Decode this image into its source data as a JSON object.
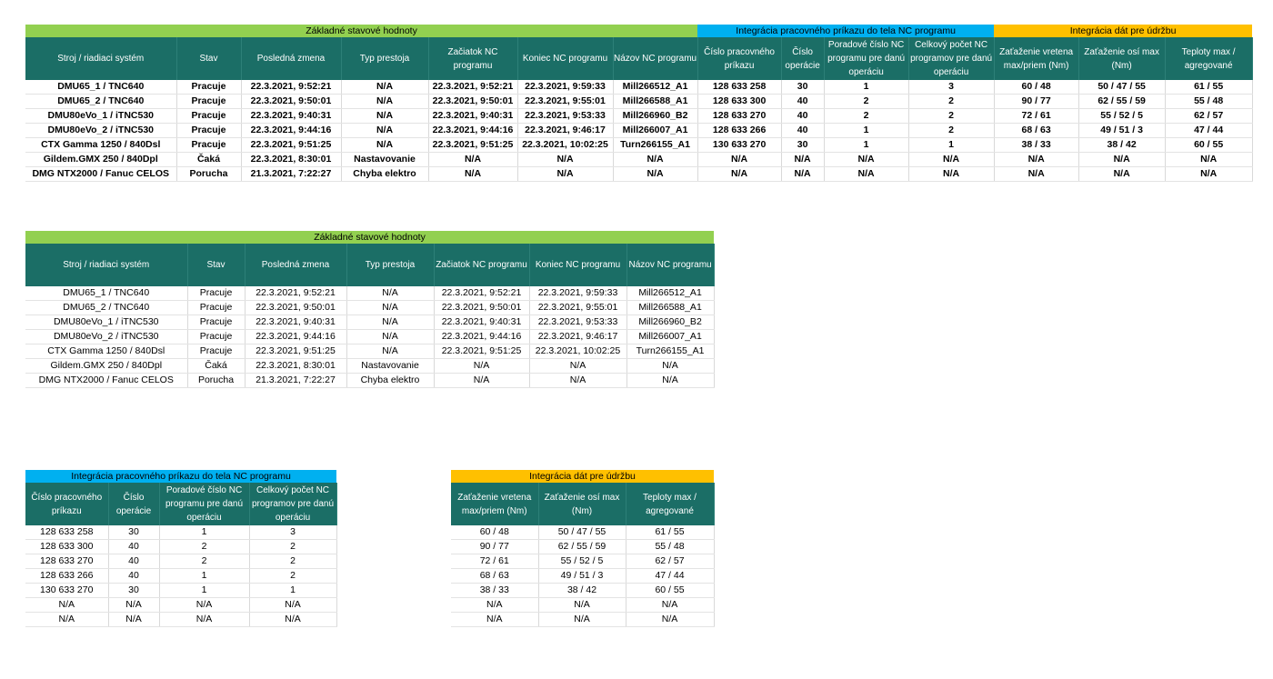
{
  "section_titles": {
    "basic": "Základné stavové hodnoty",
    "work_order": "Integrácia pracovného príkazu do tela NC programu",
    "maintenance": "Integrácia dát pre údržbu"
  },
  "columns": {
    "basic": [
      "Stroj / riadiaci systém",
      "Stav",
      "Posledná zmena",
      "Typ prestoja",
      "Začiatok NC programu",
      "Koniec NC programu",
      "Názov NC programu"
    ],
    "work_order": [
      "Číslo pracovného príkazu",
      "Číslo operácie",
      "Poradové číslo NC programu pre danú operáciu",
      "Celkový počet NC programov pre danú operáciu"
    ],
    "maintenance": [
      "Zaťaženie vretena max/priem (Nm)",
      "Zaťaženie osí max (Nm)",
      "Teploty max / agregované"
    ]
  },
  "rows": {
    "basic": [
      [
        "DMU65_1 / TNC640",
        "Pracuje",
        "22.3.2021, 9:52:21",
        "N/A",
        "22.3.2021, 9:52:21",
        "22.3.2021, 9:59:33",
        "Mill266512_A1"
      ],
      [
        "DMU65_2 / TNC640",
        "Pracuje",
        "22.3.2021, 9:50:01",
        "N/A",
        "22.3.2021, 9:50:01",
        "22.3.2021, 9:55:01",
        "Mill266588_A1"
      ],
      [
        "DMU80eVo_1 / iTNC530",
        "Pracuje",
        "22.3.2021, 9:40:31",
        "N/A",
        "22.3.2021, 9:40:31",
        "22.3.2021, 9:53:33",
        "Mill266960_B2"
      ],
      [
        "DMU80eVo_2 / iTNC530",
        "Pracuje",
        "22.3.2021, 9:44:16",
        "N/A",
        "22.3.2021, 9:44:16",
        "22.3.2021, 9:46:17",
        "Mill266007_A1"
      ],
      [
        "CTX Gamma 1250 / 840Dsl",
        "Pracuje",
        "22.3.2021, 9:51:25",
        "N/A",
        "22.3.2021, 9:51:25",
        "22.3.2021, 10:02:25",
        "Turn266155_A1"
      ],
      [
        "Gildem.GMX 250 / 840Dpl",
        "Čaká",
        "22.3.2021, 8:30:01",
        "Nastavovanie",
        "N/A",
        "N/A",
        "N/A"
      ],
      [
        "DMG NTX2000 / Fanuc CELOS",
        "Porucha",
        "21.3.2021, 7:22:27",
        "Chyba elektro",
        "N/A",
        "N/A",
        "N/A"
      ]
    ],
    "work_order": [
      [
        "128 633 258",
        "30",
        "1",
        "3"
      ],
      [
        "128 633 300",
        "40",
        "2",
        "2"
      ],
      [
        "128 633 270",
        "40",
        "2",
        "2"
      ],
      [
        "128 633 266",
        "40",
        "1",
        "2"
      ],
      [
        "130 633 270",
        "30",
        "1",
        "1"
      ],
      [
        "N/A",
        "N/A",
        "N/A",
        "N/A"
      ],
      [
        "N/A",
        "N/A",
        "N/A",
        "N/A"
      ]
    ],
    "maintenance": [
      [
        "60 / 48",
        "50 / 47 / 55",
        "61 / 55"
      ],
      [
        "90 / 77",
        "62 / 55 / 59",
        "55 / 48"
      ],
      [
        "72 / 61",
        "55 / 52 / 5",
        "62 / 57"
      ],
      [
        "68 / 63",
        "49 / 51 / 3",
        "47 / 44"
      ],
      [
        "38 / 33",
        "38 / 42",
        "60 / 55"
      ],
      [
        "N/A",
        "N/A",
        "N/A"
      ],
      [
        "N/A",
        "N/A",
        "N/A"
      ]
    ]
  },
  "colors": {
    "basic_band": "#92d050",
    "work_order_band": "#00b0f0",
    "maintenance_band": "#ffc000",
    "header_bg": "#1b6e66",
    "header_text": "#ffffff"
  }
}
